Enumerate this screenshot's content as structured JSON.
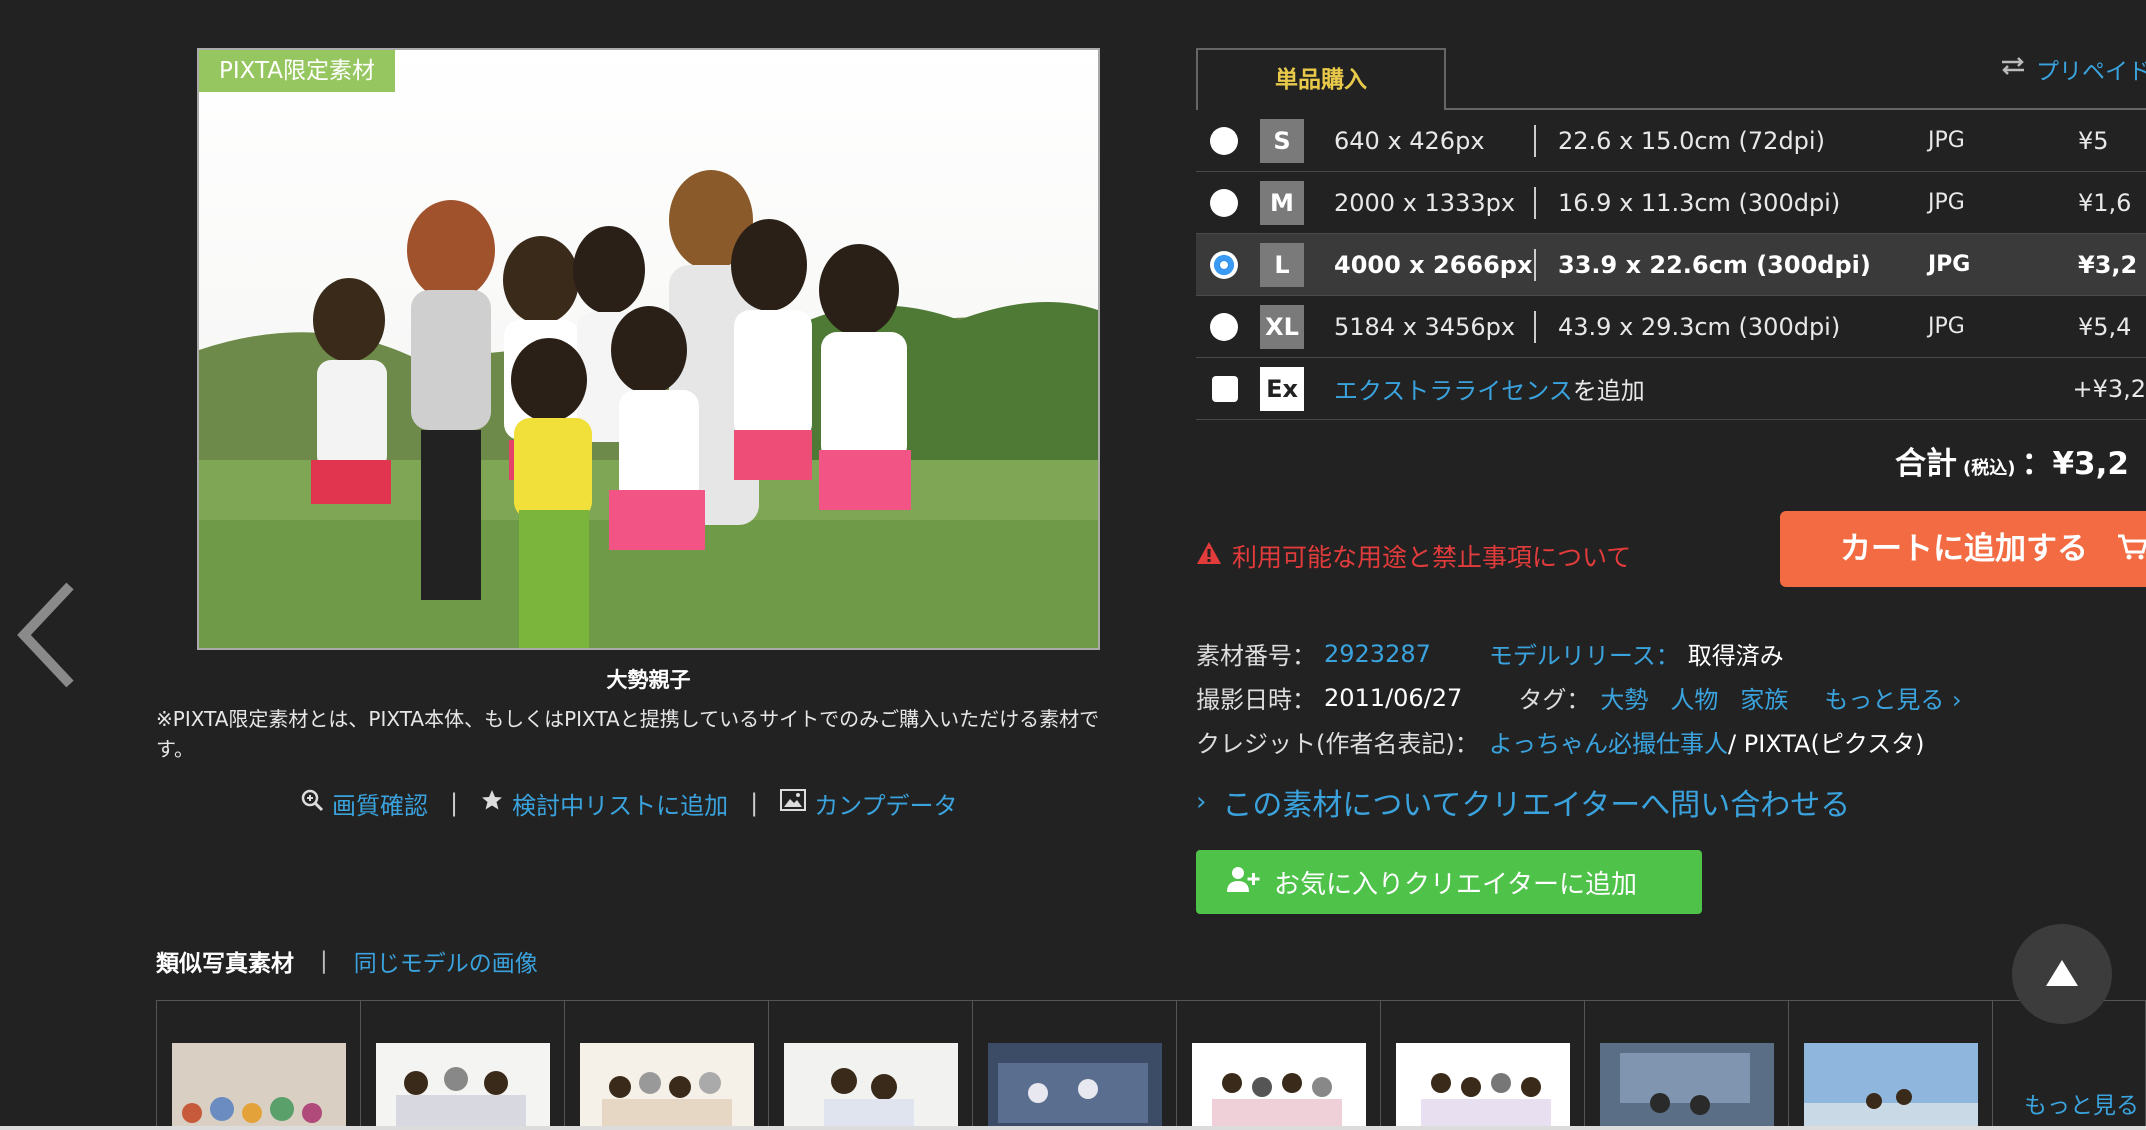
{
  "photo": {
    "badge": "PIXTA限定素材",
    "title": "大勢親子",
    "note": "※PIXTA限定素材とは、PIXTA本体、もしくはPIXTAと提携しているサイトでのみご購入いただける素材です。"
  },
  "photo_actions": {
    "quality_check": "画質確認",
    "add_to_list": "検討中リストに追加",
    "comp_data": "カンプデータ"
  },
  "purchase": {
    "tab_single": "単品購入",
    "tab_prepaid": "プリペイド",
    "sizes": [
      {
        "code": "S",
        "px": "640 x 426px",
        "cm": "22.6 x 15.0cm (72dpi)",
        "format": "JPG",
        "price": "¥5",
        "selected": false
      },
      {
        "code": "M",
        "px": "2000 x 1333px",
        "cm": "16.9 x 11.3cm (300dpi)",
        "format": "JPG",
        "price": "¥1,6",
        "selected": false
      },
      {
        "code": "L",
        "px": "4000 x 2666px",
        "cm": "33.9 x 22.6cm (300dpi)",
        "format": "JPG",
        "price": "¥3,2",
        "selected": true
      },
      {
        "code": "XL",
        "px": "5184 x 3456px",
        "cm": "43.9 x 29.3cm (300dpi)",
        "format": "JPG",
        "price": "¥5,4",
        "selected": false
      }
    ],
    "extra": {
      "code": "Ex",
      "link": "エクストラライセンス",
      "suffix": "を追加",
      "price": "+¥3,2"
    },
    "total_label": "合計",
    "total_tax": "(税込)",
    "total_value": "：¥3,2",
    "warning": "利用可能な用途と禁止事項について",
    "add_cart": "カートに追加する"
  },
  "meta": {
    "material_no_label": "素材番号：",
    "material_no": "2923287",
    "model_release_label": "モデルリリース：",
    "model_release": "取得済み",
    "date_label": "撮影日時：",
    "date": "2011/06/27",
    "tags_label": "タグ：",
    "tags": [
      "大勢",
      "人物",
      "家族"
    ],
    "tags_more": "もっと見る",
    "credit_label": "クレジット(作者名表記)：",
    "credit_author": "よっちゃん必撮仕事人",
    "credit_suffix": " / PIXTA(ピクスタ)",
    "contact_creator": "この素材についてクリエイターへ問い合わせる",
    "fav_creator": "お気に入りクリエイターに追加"
  },
  "similar": {
    "tab_active": "類似写真素材",
    "tab_other": "同じモデルの画像",
    "more": "もっと見る"
  },
  "colors": {
    "background": "#222222",
    "link": "#3aa3dd",
    "cart_button": "#f26b42",
    "fav_button": "#4fc24a",
    "badge": "#96c65f",
    "warning": "#e23b3b"
  }
}
